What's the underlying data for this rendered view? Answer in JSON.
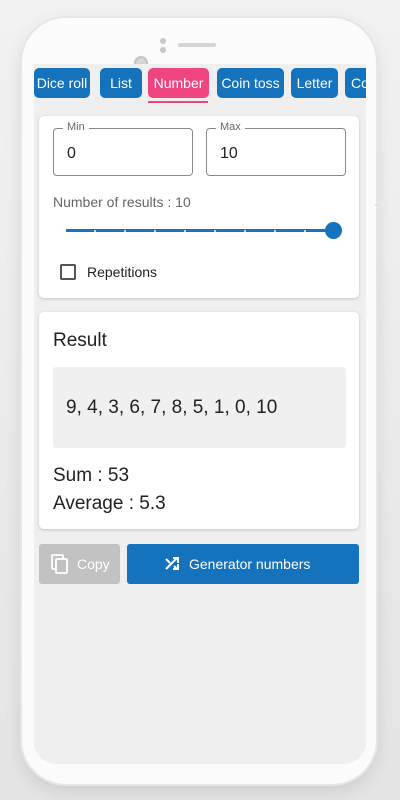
{
  "tabs": [
    {
      "label": "Dice roll",
      "active": false
    },
    {
      "label": "List",
      "active": false
    },
    {
      "label": "Number",
      "active": true
    },
    {
      "label": "Coin toss",
      "active": false
    },
    {
      "label": "Letter",
      "active": false
    },
    {
      "label": "Co",
      "active": false
    }
  ],
  "settings": {
    "min_label": "Min",
    "min_value": "0",
    "max_label": "Max",
    "max_value": "10",
    "results_label": "Number of results : 10",
    "slider_value_fraction": 1.0,
    "repetitions_label": "Repetitions",
    "repetitions_checked": false
  },
  "result": {
    "title": "Result",
    "numbers": "9, 4, 3, 6, 7, 8, 5, 1, 0, 10",
    "sum": "Sum : 53",
    "average": "Average : 5.3"
  },
  "actions": {
    "copy_label": "Copy",
    "copy_enabled": false,
    "generate_label": "Generator numbers"
  },
  "colors": {
    "primary": "#1572bd",
    "accent": "#ee4580",
    "disabled": "#c2c2c2"
  },
  "icons": {
    "copy": "copy-icon",
    "generate": "shuffle-icon"
  }
}
